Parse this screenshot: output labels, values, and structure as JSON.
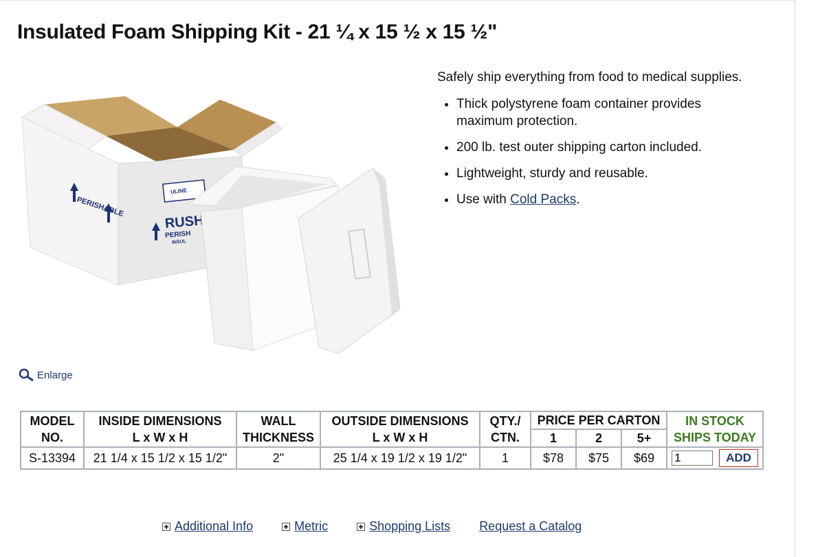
{
  "product": {
    "title": "Insulated Foam Shipping Kit - 21 ¼ x 15 ½ x 15 ½\"",
    "enlarge_label": "Enlarge",
    "image_text": {
      "perishable": "PERISHABLE",
      "uline": "ULINE",
      "rush": "RUSH",
      "perish2": "PERISH",
      "insul": "INSUL",
      "up": "UP"
    }
  },
  "description": {
    "intro": "Safely ship everything from food to medical supplies.",
    "bullets": [
      "Thick polystyrene foam container provides maximum protection.",
      "200 lb. test outer shipping carton included.",
      "Lightweight, sturdy and reusable."
    ],
    "use_with_prefix": "Use with ",
    "cold_packs_link": "Cold Packs",
    "use_with_suffix": "."
  },
  "spec_table": {
    "headers": {
      "model_1": "MODEL",
      "model_2": "NO.",
      "inside_1": "INSIDE DIMENSIONS",
      "inside_2": "L x W x H",
      "wall_1": "WALL",
      "wall_2": "THICKNESS",
      "outside_1": "OUTSIDE DIMENSIONS",
      "outside_2": "L x W x H",
      "qty_1": "QTY./",
      "qty_2": "CTN.",
      "price": "PRICE PER CARTON",
      "tier1": "1",
      "tier2": "2",
      "tier3": "5+",
      "stock_1": "IN STOCK",
      "stock_2": "SHIPS TODAY"
    },
    "row": {
      "model": "S-13394",
      "inside": "21 1/4 x 15 1/2 x 15 1/2\"",
      "wall": "2\"",
      "outside": "25 1/4 x 19 1/2 x 19 1/2\"",
      "qty": "1",
      "price1": "$78",
      "price2": "$75",
      "price3": "$69",
      "qty_value": "1",
      "add_label": "ADD"
    }
  },
  "footer_links": {
    "additional_info": "Additional Info",
    "metric": "Metric",
    "shopping_lists": "Shopping Lists",
    "request_catalog": "Request a Catalog"
  },
  "colors": {
    "link": "#1f3a6b",
    "stock_green": "#3a7a1e",
    "add_border": "#c0301f",
    "table_border": "#aab0b8"
  }
}
